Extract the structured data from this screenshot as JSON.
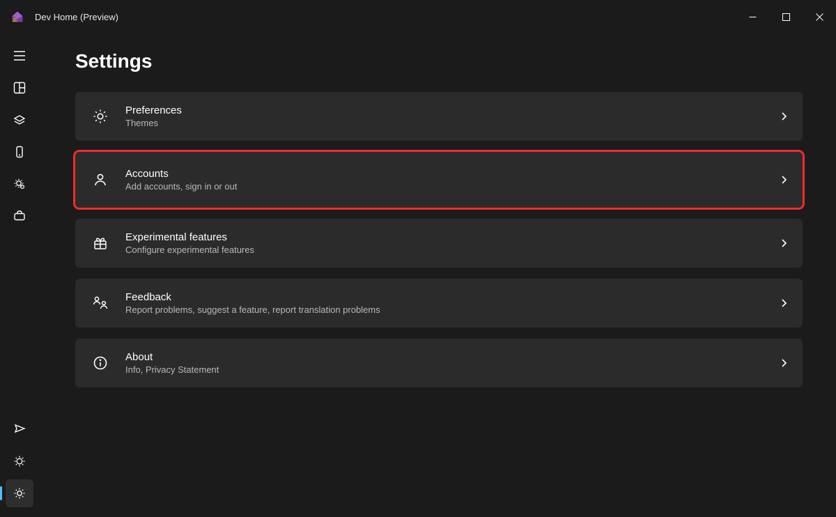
{
  "app": {
    "title": "Dev Home (Preview)"
  },
  "page": {
    "title": "Settings"
  },
  "items": [
    {
      "icon": "gear",
      "title": "Preferences",
      "subtitle": "Themes",
      "highlighted": false
    },
    {
      "icon": "person",
      "title": "Accounts",
      "subtitle": "Add accounts, sign in or out",
      "highlighted": true
    },
    {
      "icon": "gift",
      "title": "Experimental features",
      "subtitle": "Configure experimental features",
      "highlighted": false
    },
    {
      "icon": "feedback",
      "title": "Feedback",
      "subtitle": "Report problems, suggest a feature, report translation problems",
      "highlighted": false
    },
    {
      "icon": "info",
      "title": "About",
      "subtitle": "Info, Privacy Statement",
      "highlighted": false
    }
  ],
  "highlight_color": "#ef2c2c"
}
